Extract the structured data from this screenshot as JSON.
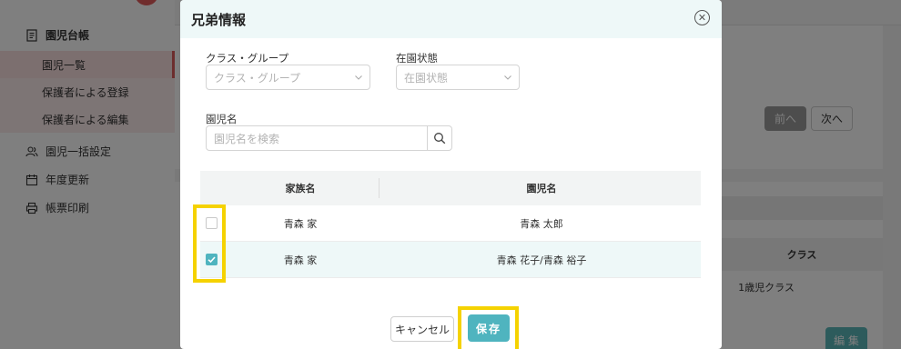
{
  "sidebar": {
    "group_label": "園児台帳",
    "sub_items": [
      {
        "label": "園児一覧"
      },
      {
        "label": "保護者による登録"
      },
      {
        "label": "保護者による編集"
      }
    ],
    "items": [
      {
        "label": "園児一括設定",
        "icon": "users-icon"
      },
      {
        "label": "年度更新",
        "icon": "calendar-icon"
      },
      {
        "label": "帳票印刷",
        "icon": "printer-icon"
      }
    ]
  },
  "background": {
    "prev_label": "前へ",
    "next_label": "次へ",
    "class_header": "クラス",
    "class_value": "1歳児クラス",
    "edit_label": "編 集"
  },
  "modal": {
    "title": "兄弟情報",
    "close_icon": "close-circle-icon",
    "class_group_label": "クラス・グループ",
    "class_group_placeholder": "クラス・グループ",
    "status_label": "在園状態",
    "status_placeholder": "在園状態",
    "name_label": "園児名",
    "search_placeholder": "園児名を検索",
    "table": {
      "headers": [
        "家族名",
        "園児名"
      ],
      "rows": [
        {
          "family": "青森 家",
          "children": "青森 太郎",
          "checked": false
        },
        {
          "family": "青森 家",
          "children": "青森 花子/青森 裕子",
          "checked": true
        }
      ]
    },
    "cancel_label": "キャンセル",
    "save_label": "保存"
  },
  "colors": {
    "accent": "#4fb4bf",
    "highlight": "#f5d200",
    "sidebar_active": "#d95c5c"
  }
}
